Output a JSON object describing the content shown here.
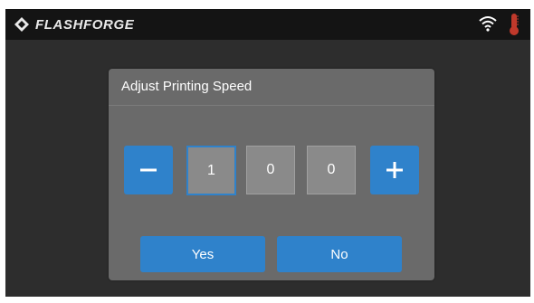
{
  "header": {
    "brand": "FLASHFORGE",
    "icons": {
      "logo": "flashforge-logo-icon",
      "wifi": "wifi-icon",
      "temperature": "thermometer-icon"
    }
  },
  "dialog": {
    "title": "Adjust Printing Speed",
    "decrement_icon": "minus-icon",
    "increment_icon": "plus-icon",
    "digits": [
      "1",
      "0",
      "0"
    ],
    "yes_label": "Yes",
    "no_label": "No"
  },
  "colors": {
    "accent": "#2f82cb",
    "thermometer": "#c0392b",
    "screen_bg": "#2d2d2d",
    "topbar_bg": "#141414",
    "dialog_bg": "#6a6a6a"
  }
}
